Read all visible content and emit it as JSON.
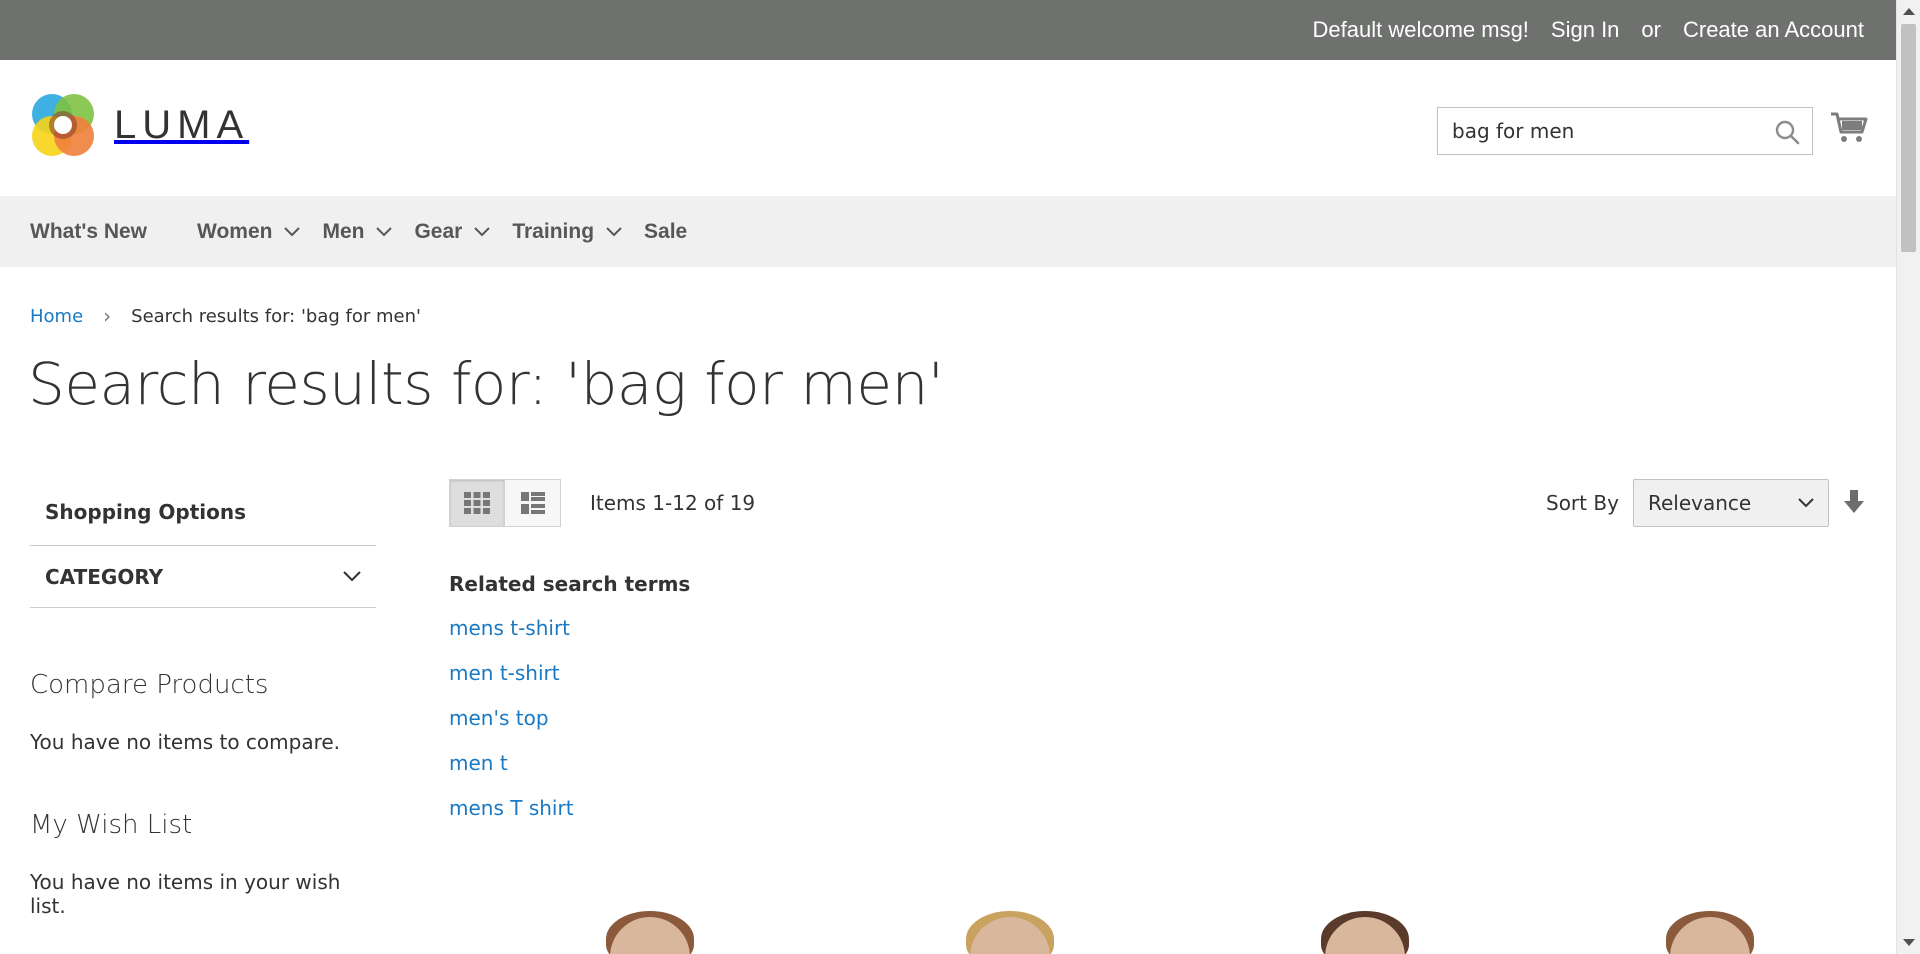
{
  "topbar": {
    "welcome": "Default welcome msg!",
    "sign_in": "Sign In",
    "or": "or",
    "create_account": "Create an Account"
  },
  "header": {
    "logo_text": "LUMA",
    "search_value": "bag for men"
  },
  "nav": {
    "items": [
      {
        "label": "What's New",
        "has_submenu": false
      },
      {
        "label": "Women",
        "has_submenu": true
      },
      {
        "label": "Men",
        "has_submenu": true
      },
      {
        "label": "Gear",
        "has_submenu": true
      },
      {
        "label": "Training",
        "has_submenu": true
      },
      {
        "label": "Sale",
        "has_submenu": false
      }
    ]
  },
  "breadcrumb": {
    "home": "Home",
    "current": "Search results for: 'bag for men'"
  },
  "page_title": "Search results for: 'bag for men'",
  "sidebar": {
    "shopping_options": "Shopping Options",
    "category_filter": "CATEGORY",
    "compare_title": "Compare Products",
    "compare_empty": "You have no items to compare.",
    "wishlist_title": "My Wish List",
    "wishlist_empty": "You have no items in your wish list."
  },
  "toolbar": {
    "amount": "Items 1-12 of 19",
    "sort_label": "Sort By",
    "sort_value": "Relevance"
  },
  "related": {
    "title": "Related search terms",
    "terms": [
      "mens t-shirt",
      "men t-shirt",
      "men's top",
      "men t",
      "mens T shirt"
    ]
  },
  "colors": {
    "topbar_bg": "#6e716e",
    "nav_bg": "#f0f0f0",
    "link": "#1979c3",
    "text": "#333333"
  }
}
